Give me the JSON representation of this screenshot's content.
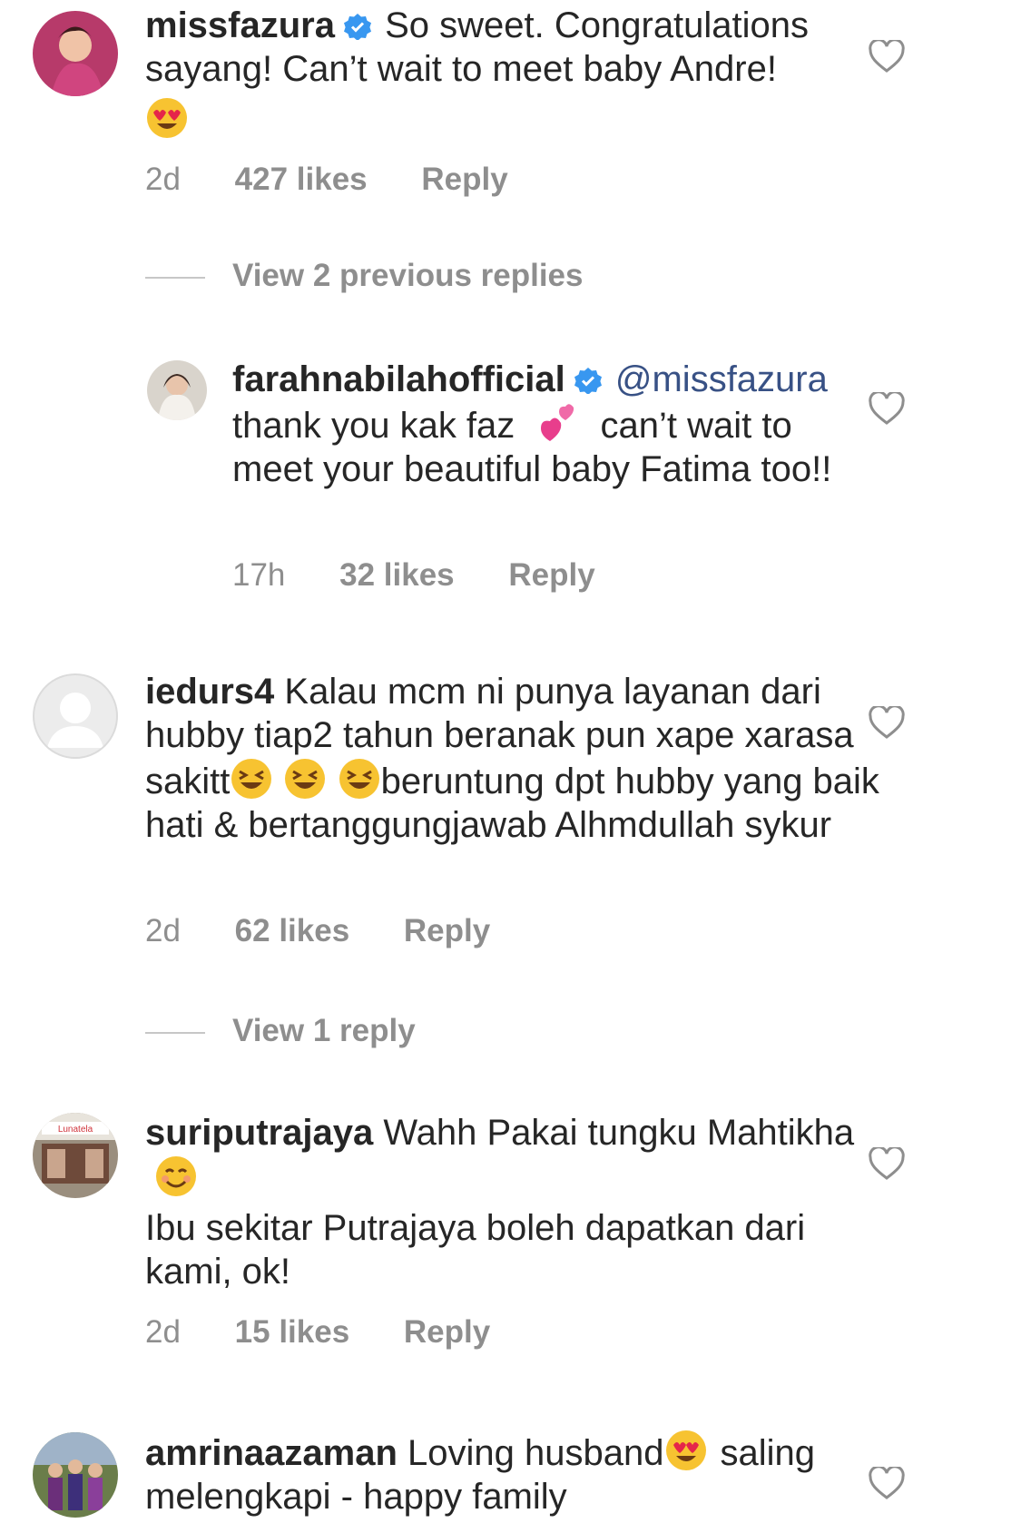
{
  "comments": [
    {
      "username": "missfazura",
      "text_before_emoji": "So sweet. Congratulations sayang! Can’t wait to meet baby Andre!",
      "time": "2d",
      "likes": "427 likes",
      "reply": "Reply",
      "view_replies": "View 2 previous replies"
    },
    {
      "username": "farahnabilahofficial",
      "mention": "@missfazura",
      "text_part1": "thank you kak faz",
      "text_part2": "can’t wait to meet your beautiful baby Fatima too!!",
      "time": "17h",
      "likes": "32 likes",
      "reply": "Reply"
    },
    {
      "username": "iedurs4",
      "text_part1": "Kalau mcm ni punya layanan dari hubby tiap2 tahun beranak pun xape xarasa sakitt",
      "text_part2": "beruntung dpt hubby yang baik hati & bertanggungjawab Alhmdullah sykur",
      "time": "2d",
      "likes": "62 likes",
      "reply": "Reply",
      "view_replies": "View 1 reply"
    },
    {
      "username": "suriputrajaya",
      "text_part1": "Wahh Pakai tungku Mahtikha",
      "text_part2": "Ibu sekitar Putrajaya boleh dapatkan dari kami, ok!",
      "time": "2d",
      "likes": "15 likes",
      "reply": "Reply"
    },
    {
      "username": "amrinaazaman",
      "text_part1": "Loving husband",
      "text_part2": "saling melengkapi - happy family"
    }
  ],
  "colors": {
    "text": "#262626",
    "secondary": "#8e8e8e",
    "mention": "#385185",
    "verified": "#3897f0"
  }
}
